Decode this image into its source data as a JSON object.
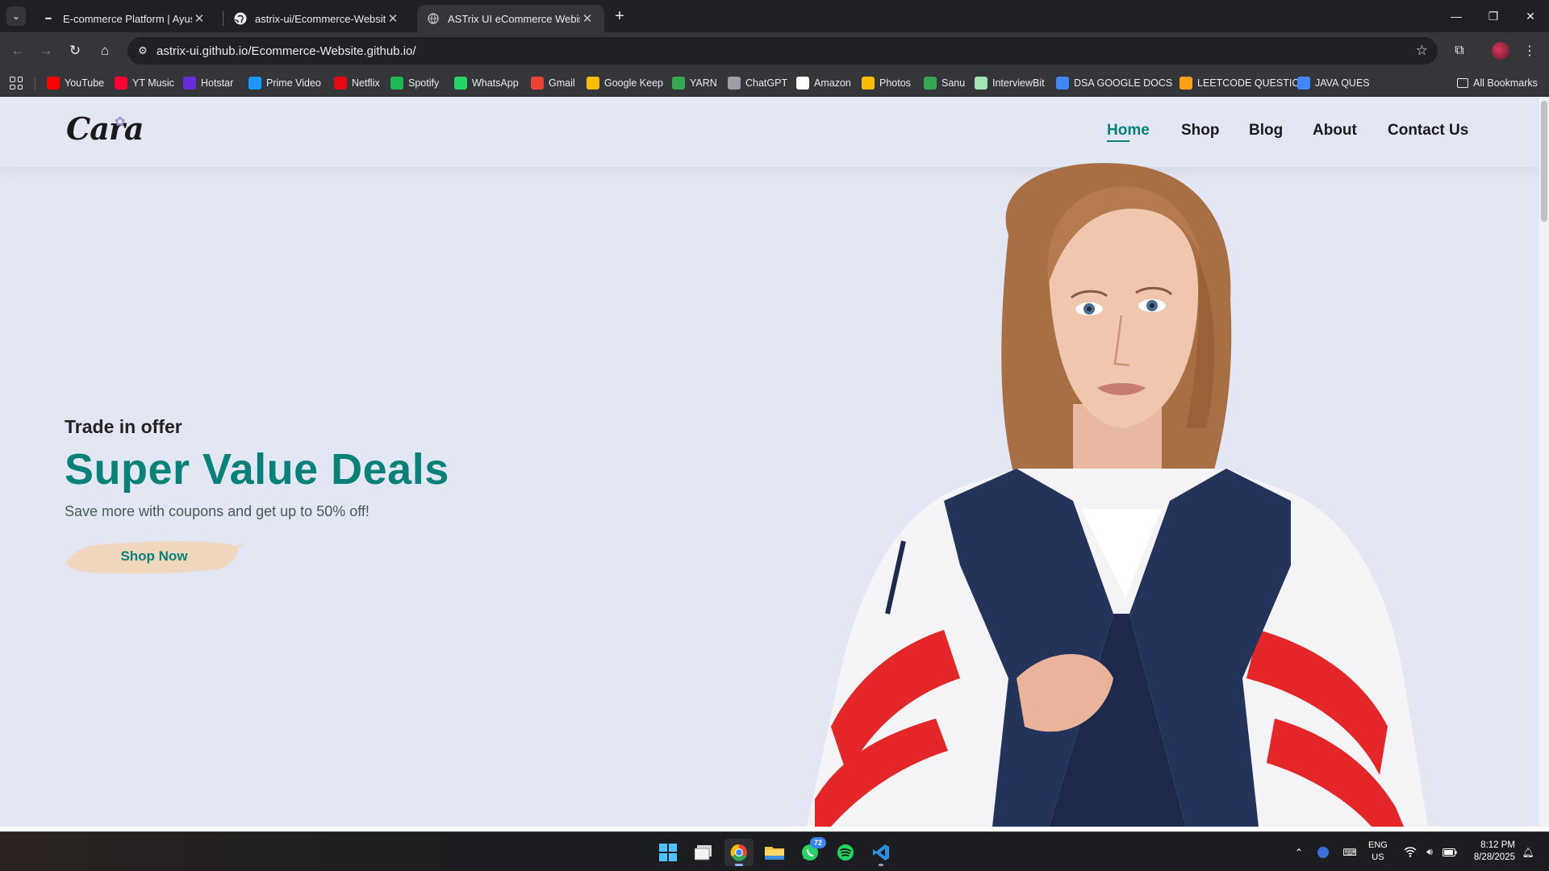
{
  "browser": {
    "tabs": [
      {
        "title": "E-commerce Platform | Ayush S",
        "active": false
      },
      {
        "title": "astrix-ui/Ecommerce-Website.g",
        "active": false
      },
      {
        "title": "ASTrix UI eCommerce Webiste",
        "active": true
      }
    ],
    "url": {
      "host": "astrix-ui.github.io",
      "path": "/Ecommerce-Website.github.io/"
    },
    "bookmarks": [
      {
        "label": "YouTube",
        "icon": "youtube-icon",
        "color": "#ff0000"
      },
      {
        "label": "YT Music",
        "icon": "yt-music-icon",
        "color": "#ff0033"
      },
      {
        "label": "Hotstar",
        "icon": "hotstar-icon",
        "color": "#6a2bd9"
      },
      {
        "label": "Prime Video",
        "icon": "prime-video-icon",
        "color": "#1a98ff"
      },
      {
        "label": "Netflix",
        "icon": "netflix-icon",
        "color": "#e50914"
      },
      {
        "label": "Spotify",
        "icon": "spotify-icon",
        "color": "#1db954"
      },
      {
        "label": "WhatsApp",
        "icon": "whatsapp-icon",
        "color": "#25d366"
      },
      {
        "label": "Gmail",
        "icon": "gmail-icon",
        "color": "#ea4335"
      },
      {
        "label": "Google Keep",
        "icon": "google-keep-icon",
        "color": "#fbbc04"
      },
      {
        "label": "YARN",
        "icon": "yarn-icon",
        "color": "#34a853"
      },
      {
        "label": "ChatGPT",
        "icon": "chatgpt-icon",
        "color": "#9aa0a6"
      },
      {
        "label": "Amazon",
        "icon": "amazon-icon",
        "color": "#ffffff"
      },
      {
        "label": "Photos",
        "icon": "photos-icon",
        "color": "#fbbc04"
      },
      {
        "label": "Sanu",
        "icon": "sanu-icon",
        "color": "#34a853"
      },
      {
        "label": "InterviewBit",
        "icon": "interviewbit-icon",
        "color": "#a3e4b7"
      },
      {
        "label": "DSA GOOGLE DOCS",
        "icon": "docs-icon",
        "color": "#4285f4"
      },
      {
        "label": "LEETCODE QUESTIO...",
        "icon": "leetcode-icon",
        "color": "#ffa116"
      },
      {
        "label": "JAVA QUES",
        "icon": "docs-icon",
        "color": "#4285f4"
      }
    ],
    "all_bookmarks": "All Bookmarks"
  },
  "site": {
    "logo": "Cara",
    "nav": [
      "Home",
      "Shop",
      "Blog",
      "About",
      "Contact Us"
    ],
    "active_nav": "Home",
    "hero": {
      "kicker": "Trade in offer",
      "title": "Super Value Deals",
      "subtitle": "Save more with coupons and get up to 50% off!",
      "cta": "Shop Now"
    },
    "colors": {
      "accent": "#088178",
      "background": "#e3e6f3",
      "cta_brush": "#f0d7bd"
    }
  },
  "taskbar": {
    "whatsapp_badge": "72",
    "language": [
      "ENG",
      "US"
    ],
    "time": "8:12 PM",
    "date": "8/28/2025"
  }
}
